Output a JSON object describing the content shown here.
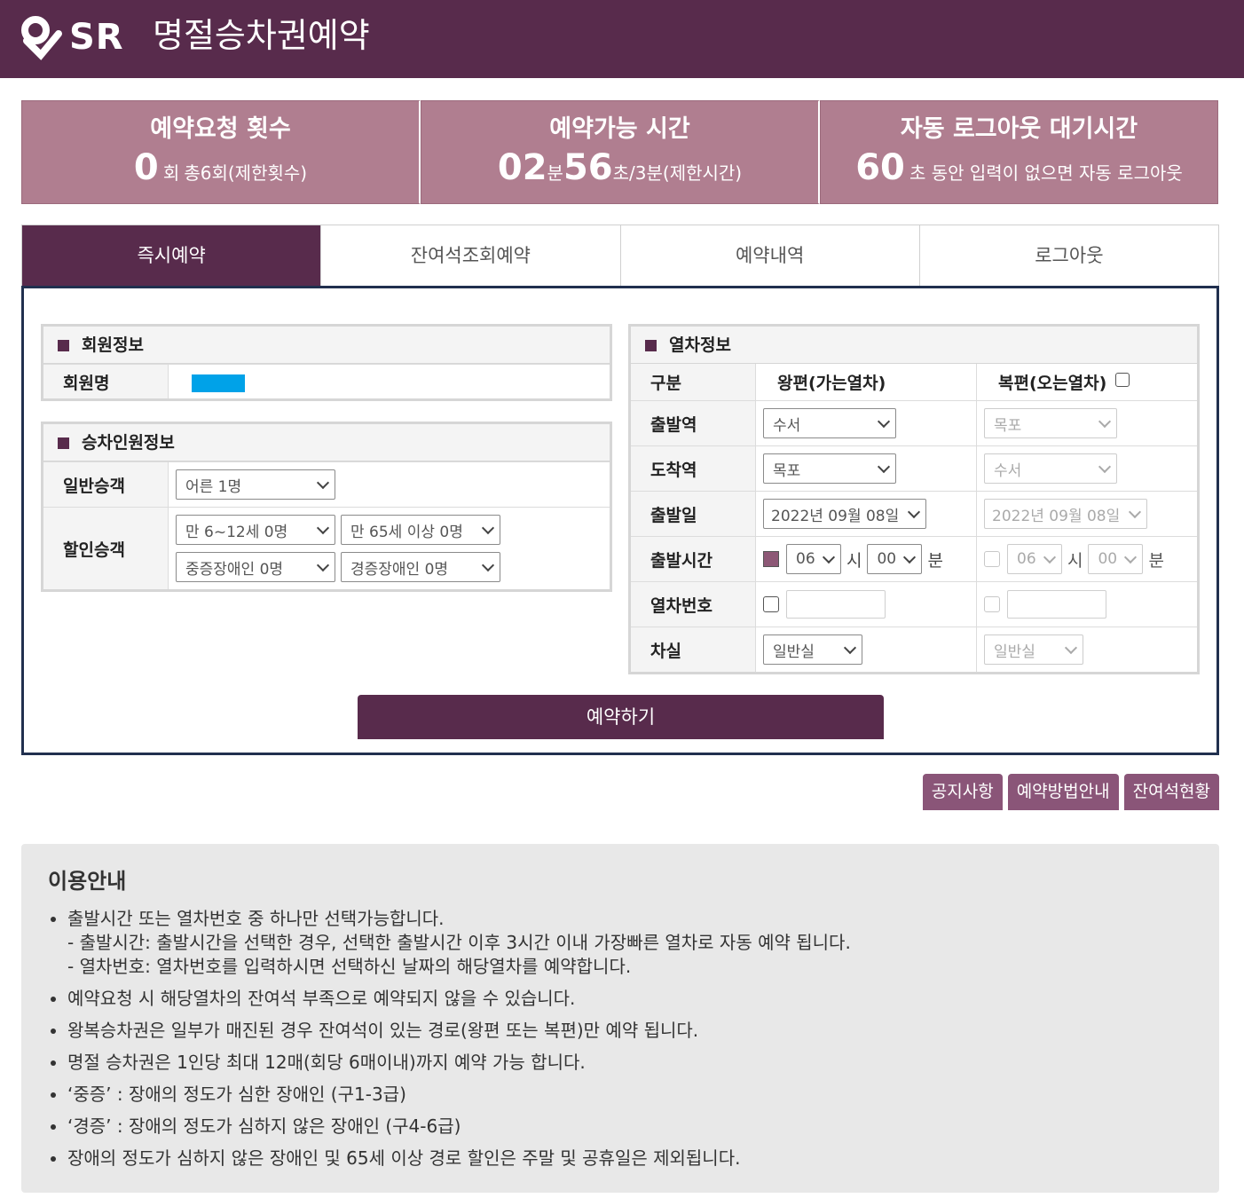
{
  "header": {
    "logo_text": "SR",
    "title": "명절승차권예약"
  },
  "stats": {
    "requests": {
      "title": "예약요청 횟수",
      "count": "0",
      "unit": "회",
      "limit": "총6회(제한횟수)"
    },
    "available": {
      "title": "예약가능 시간",
      "min": "02",
      "min_unit": "분",
      "sec": "56",
      "sec_unit": "초",
      "limit": "/3분(제한시간)"
    },
    "logout": {
      "title": "자동 로그아웃 대기시간",
      "sec": "60",
      "desc": "초 동안 입력이 없으면 자동 로그아웃"
    }
  },
  "tabs": [
    {
      "label": "즉시예약"
    },
    {
      "label": "잔여석조회예약"
    },
    {
      "label": "예약내역"
    },
    {
      "label": "로그아웃"
    }
  ],
  "member": {
    "title": "회원정보",
    "name_label": "회원명"
  },
  "passengers": {
    "title": "승차인원정보",
    "general_label": "일반승객",
    "general_value": "어른 1명",
    "discount_label": "할인승객",
    "child": "만 6~12세 0명",
    "senior": "만 65세 이상 0명",
    "severe": "중증장애인 0명",
    "mild": "경증장애인 0명"
  },
  "train": {
    "title": "열차정보",
    "col_label": "구분",
    "col_out": "왕편(가는열차)",
    "col_return": "복편(오는열차)",
    "dep_label": "출발역",
    "arr_label": "도착역",
    "date_label": "출발일",
    "time_label": "출발시간",
    "no_label": "열차번호",
    "class_label": "차실",
    "out_dep": "수서",
    "out_arr": "목포",
    "out_date": "2022년 09월 08일",
    "out_hour": "06",
    "out_min": "00",
    "ret_dep": "목포",
    "ret_arr": "수서",
    "ret_date": "2022년 09월 08일",
    "ret_hour": "06",
    "ret_min": "00",
    "hour_unit": "시",
    "min_unit": "분",
    "out_class": "일반실",
    "ret_class": "일반실"
  },
  "reserve_button": "예약하기",
  "side_buttons": [
    "공지사항",
    "예약방법안내",
    "잔여석현황"
  ],
  "info": {
    "title": "이용안내",
    "item1": "출발시간 또는 열차번호 중 하나만 선택가능합니다.",
    "item1_sub1": "- 출발시간: 출발시간을 선택한 경우, 선택한 출발시간 이후 3시간 이내 가장빠른 열차로 자동 예약 됩니다.",
    "item1_sub2": "- 열차번호: 열차번호를 입력하시면 선택하신 날짜의 해당열차를 예약합니다.",
    "item2": "예약요청 시 해당열차의 잔여석 부족으로 예약되지 않을 수 있습니다.",
    "item3": "왕복승차권은 일부가 매진된 경우 잔여석이 있는 경로(왕편 또는 복편)만 예약 됩니다.",
    "item4": "명절 승차권은 1인당 최대 12매(회당 6매이내)까지 예약 가능 합니다.",
    "item5": "‘중증’ : 장애의 정도가 심한 장애인 (구1-3급)",
    "item6": "‘경증’ : 장애의 정도가 심하지 않은 장애인 (구4-6급)",
    "item7": "장애의 정도가 심하지 않은 장애인 및 65세 이상 경로 할인은 주말 및 공휴일은 제외됩니다."
  }
}
